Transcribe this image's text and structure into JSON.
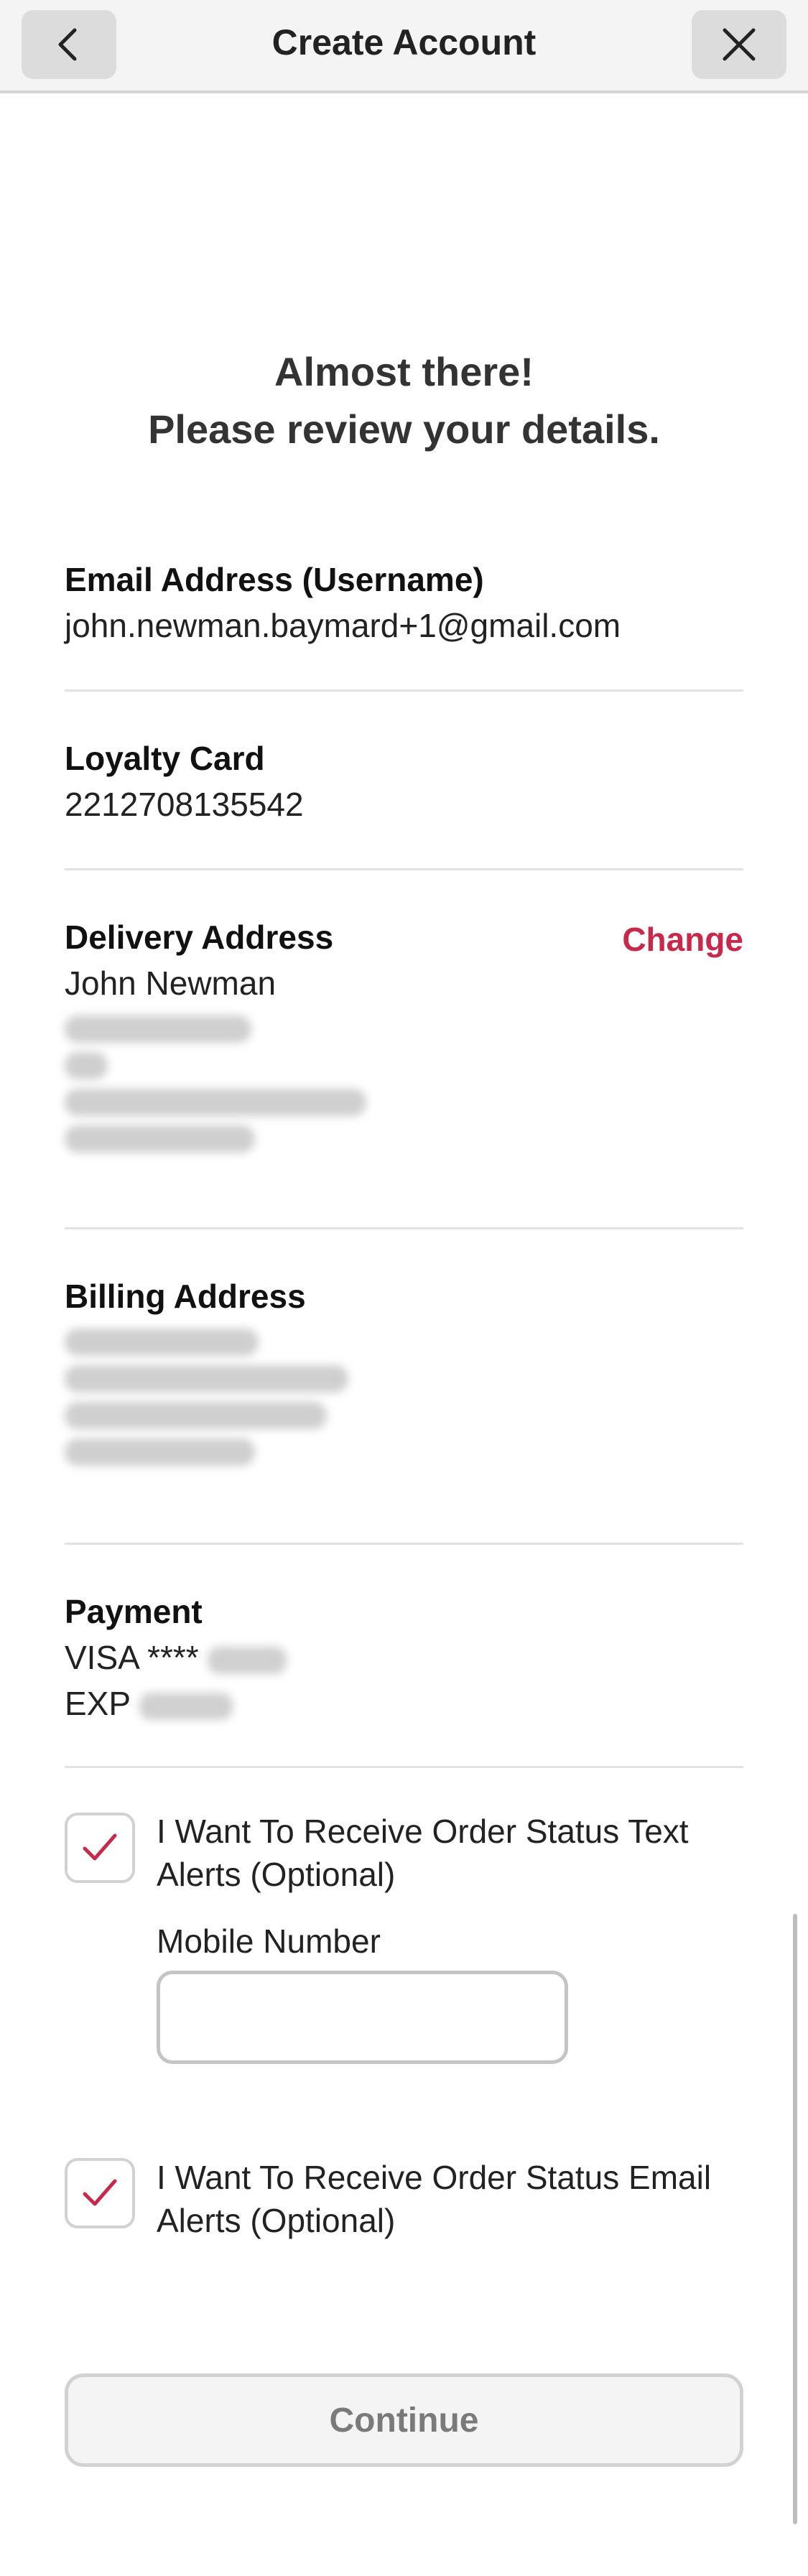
{
  "header": {
    "title": "Create Account"
  },
  "heading": {
    "line1": "Almost there!",
    "line2": "Please review your details."
  },
  "email": {
    "label": "Email Address (Username)",
    "value": "john.newman.baymard+1@gmail.com"
  },
  "loyalty": {
    "label": "Loyalty Card",
    "value": "2212708135542"
  },
  "delivery": {
    "label": "Delivery Address",
    "name": "John Newman",
    "change_label": "Change"
  },
  "billing": {
    "label": "Billing Address"
  },
  "payment": {
    "label": "Payment",
    "card_prefix": "VISA ****",
    "exp_prefix": "EXP"
  },
  "sms_opt": {
    "label": "I Want To Receive Order Status Text Alerts (Optional)",
    "checked": true
  },
  "mobile": {
    "label": "Mobile Number",
    "value": ""
  },
  "email_opt": {
    "label": "I Want To Receive Order Status Email Alerts (Optional)",
    "checked": true
  },
  "continue_label": "Continue",
  "colors": {
    "accent": "#c8294a",
    "divider": "#e2e2e2",
    "header_bg": "#f4f4f4"
  },
  "icons": {
    "back": "chevron-left-icon",
    "close": "close-icon",
    "check": "checkmark-icon"
  }
}
